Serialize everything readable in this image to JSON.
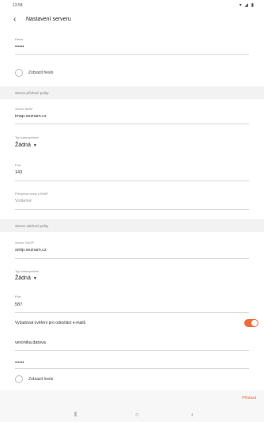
{
  "status_bar": {
    "time": "13:58",
    "icons": "▾ ◢ ▮"
  },
  "header": {
    "title": "Nastavení serveru"
  },
  "account": {
    "password_label": "Heslo",
    "password_value": "••••••",
    "show_password_label": "Zobrazit heslo"
  },
  "incoming": {
    "section_title": "Server příchozí pošty",
    "server_label": "Server IMAP",
    "server_value": "imap.seznam.cz",
    "security_label": "Typ zabezpečení",
    "security_value": "Žádná",
    "port_label": "Port",
    "port_value": "143",
    "prefix_label": "Předpona cesty k IMAP",
    "prefix_placeholder": "Volitelné"
  },
  "outgoing": {
    "section_title": "Server odchozí pošty",
    "server_label": "Server SMTP",
    "server_value": "smtp.seznam.cz",
    "security_label": "Typ zabezpečení",
    "security_value": "Žádná",
    "port_label": "Port",
    "port_value": "587",
    "auth_label": "Vyžadovat ověření pro odesílání e-mailů",
    "auth_enabled": true,
    "username_value": "veronika.datova",
    "password_value": "••••••",
    "show_password_label": "Zobrazit heslo"
  },
  "footer": {
    "save_label": "Přihlásit"
  },
  "nav": {
    "recents": "⦀",
    "home": "○",
    "back": "‹"
  },
  "colors": {
    "accent": "#f26a3a",
    "band": "#f2f2f2"
  }
}
